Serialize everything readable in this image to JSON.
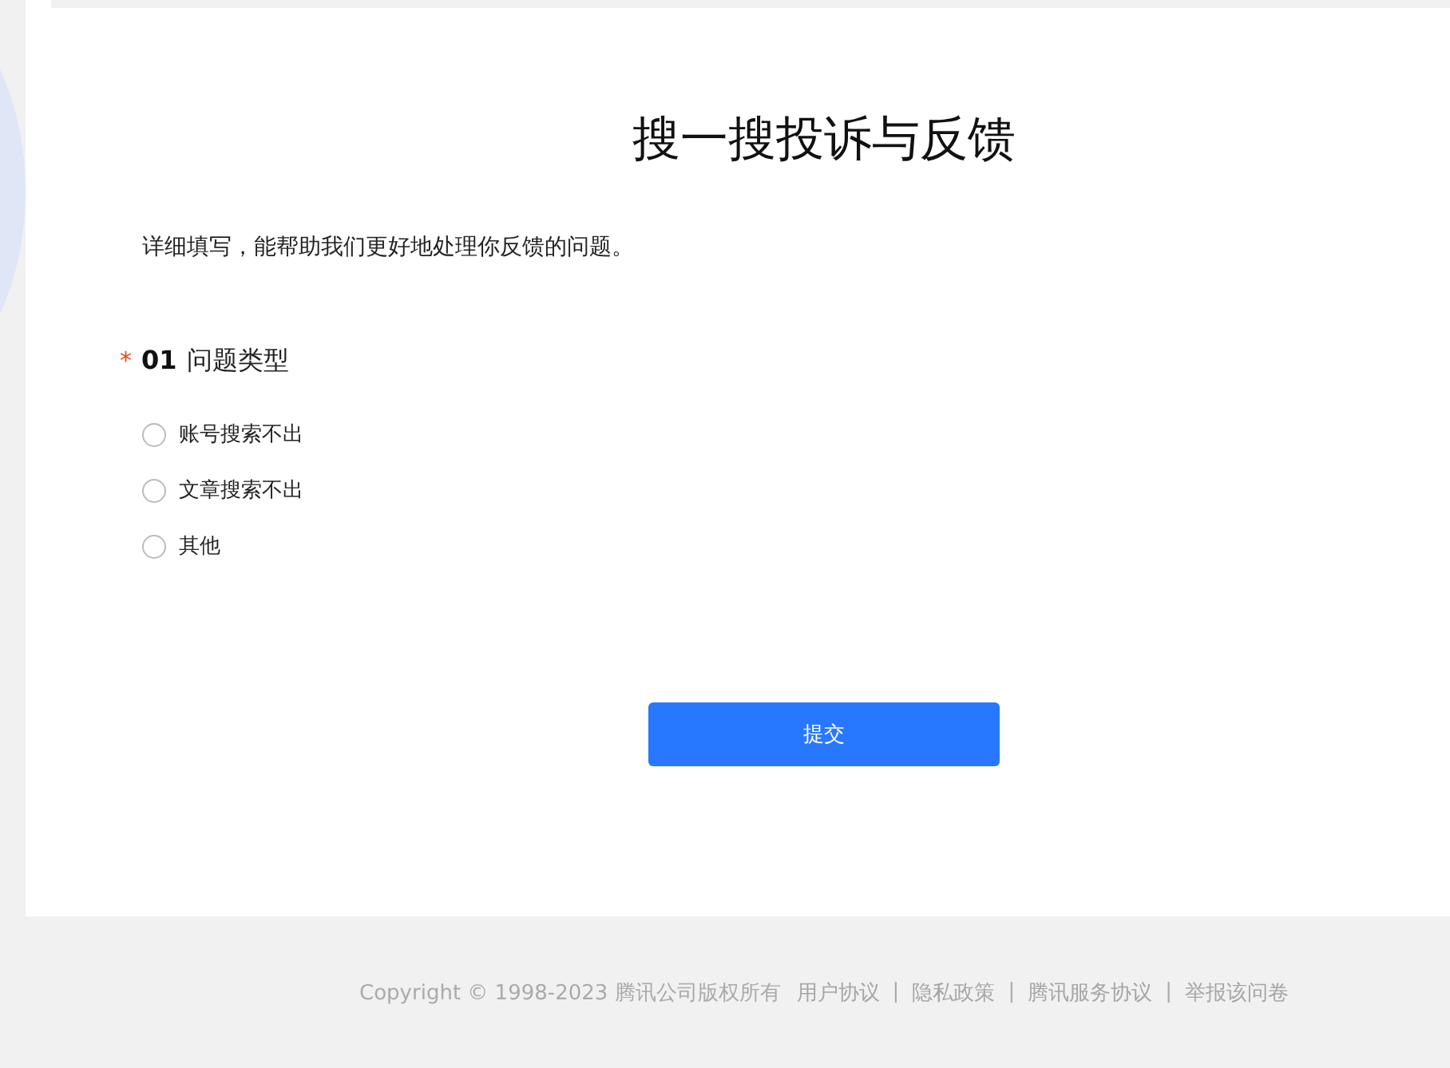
{
  "title": "搜一搜投诉与反馈",
  "description": "详细填写，能帮助我们更好地处理你反馈的问题。",
  "question": {
    "required_mark": "*",
    "number": "01",
    "label": "问题类型",
    "options": [
      {
        "label": "账号搜索不出",
        "selected": false
      },
      {
        "label": "文章搜索不出",
        "selected": false
      },
      {
        "label": "其他",
        "selected": false
      }
    ]
  },
  "submit": "提交",
  "footer": [
    {
      "kind": "copyright",
      "text": "Copyright © 1998-2023 腾讯公司版权所有"
    },
    {
      "kind": "link",
      "text": "用户协议"
    },
    {
      "kind": "separator",
      "text": "|"
    },
    {
      "kind": "link",
      "text": "隐私政策"
    },
    {
      "kind": "separator",
      "text": "|"
    },
    {
      "kind": "link",
      "text": "腾讯服务协议"
    },
    {
      "kind": "separator",
      "text": "|"
    },
    {
      "kind": "link",
      "text": "举报该问卷"
    }
  ]
}
